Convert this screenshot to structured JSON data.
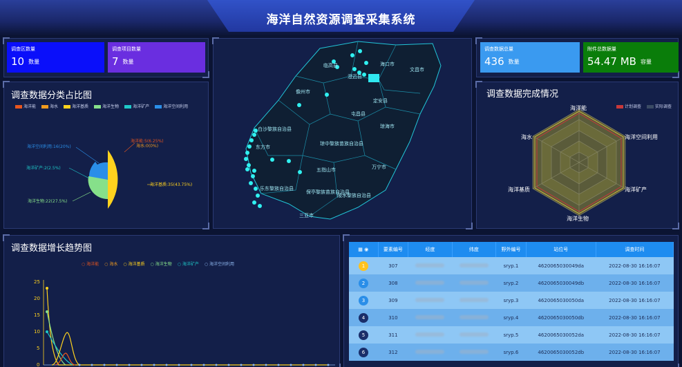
{
  "header": {
    "title": "海洋自然资源调查采集系统"
  },
  "stats": {
    "areas": {
      "label": "调查区数量",
      "value": "10",
      "unit": "数量",
      "color": "#0a0ffa"
    },
    "projects": {
      "label": "调查项目数量",
      "value": "7",
      "unit": "数量",
      "color": "#6a2ee0"
    },
    "total": {
      "label": "调查数据总量",
      "value": "436",
      "unit": "数量",
      "color": "#3a9af0"
    },
    "attachments": {
      "label": "附件总数据量",
      "value": "54.47 MB",
      "unit": "容量",
      "color": "#0a7d0a"
    }
  },
  "pie": {
    "title": "调查数据分类占比图",
    "legend": [
      {
        "name": "海洋能",
        "color": "#e8551e"
      },
      {
        "name": "海水",
        "color": "#f29b1e"
      },
      {
        "name": "海洋基质",
        "color": "#ffd21e"
      },
      {
        "name": "海洋生物",
        "color": "#86e08a"
      },
      {
        "name": "海洋矿产",
        "color": "#1ec8c8"
      },
      {
        "name": "海洋空间利用",
        "color": "#2a8ee8"
      }
    ],
    "labels": {
      "energy": "海洋能:5(6.25%)",
      "water": "海水:0(0%)",
      "substrate": "海洋基质:35(43.75%)",
      "space": "海洋空间利用:16(20%)",
      "mineral": "海洋矿产:2(2.5%)",
      "bio": "海洋生物:22(27.5%)"
    }
  },
  "map": {
    "places": [
      "海口市",
      "文昌市",
      "临高县",
      "澄迈县",
      "定安县",
      "儋州市",
      "屯昌县",
      "琼海市",
      "白沙黎族自治县",
      "琼中黎族苗族自治县",
      "东方市",
      "万宁市",
      "五指山市",
      "乐东黎族自治县",
      "保亭黎族苗族自治县",
      "陵水黎族自治县",
      "三亚市"
    ]
  },
  "radar": {
    "title": "调查数据完成情况",
    "legend": [
      {
        "name": "计划调查",
        "color": "#c8383a"
      },
      {
        "name": "实际调查",
        "color": "#3a4a64"
      }
    ],
    "axes": [
      "海洋能",
      "海洋空间利用",
      "海洋矿产",
      "海洋生物",
      "海洋基质",
      "海水"
    ]
  },
  "trend": {
    "title": "调查数据增长趋势图",
    "legend": [
      {
        "name": "海洋能",
        "color": "#e8551e"
      },
      {
        "name": "海水",
        "color": "#f29b1e"
      },
      {
        "name": "海洋基质",
        "color": "#ffd21e"
      },
      {
        "name": "海洋生物",
        "color": "#86e08a"
      },
      {
        "name": "海洋矿产",
        "color": "#1ec8c8"
      },
      {
        "name": "海洋空间利用",
        "color": "#8fb8f0"
      }
    ],
    "yticks": [
      "25",
      "20",
      "15",
      "10",
      "5",
      "0"
    ]
  },
  "table": {
    "headers": [
      "要素编号",
      "经度",
      "纬度",
      "野外编号",
      "站位号",
      "调查时间"
    ],
    "rows": [
      {
        "idx": "1",
        "id": "307",
        "field": "sryp.1",
        "station": "4620065030049da",
        "time": "2022-08-30 16:16:07"
      },
      {
        "idx": "2",
        "id": "308",
        "field": "sryp.2",
        "station": "4620065030049db",
        "time": "2022-08-30 16:16:07"
      },
      {
        "idx": "3",
        "id": "309",
        "field": "sryp.3",
        "station": "4620065030050da",
        "time": "2022-08-30 16:16:07"
      },
      {
        "idx": "4",
        "id": "310",
        "field": "sryp.4",
        "station": "4620065030050db",
        "time": "2022-08-30 16:16:07"
      },
      {
        "idx": "5",
        "id": "311",
        "field": "sryp.5",
        "station": "4620065030052da",
        "time": "2022-08-30 16:16:07"
      },
      {
        "idx": "6",
        "id": "312",
        "field": "sryp.6",
        "station": "4620065030052db",
        "time": "2022-08-30 16:16:07"
      }
    ]
  }
}
